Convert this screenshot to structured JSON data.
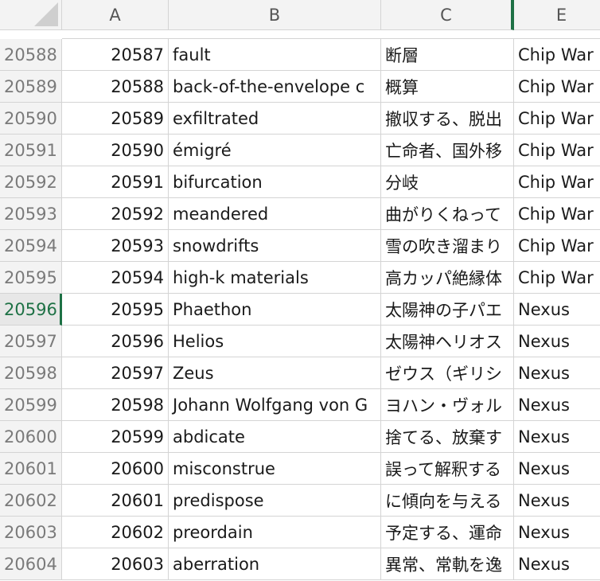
{
  "columns": [
    "A",
    "B",
    "C",
    "E"
  ],
  "active_row": "20596",
  "rows": [
    {
      "num": "20588",
      "a": "20587",
      "b": "fault",
      "c": "断層",
      "e": "Chip War"
    },
    {
      "num": "20589",
      "a": "20588",
      "b": "back-of-the-envelope c",
      "c": "概算",
      "e": "Chip War"
    },
    {
      "num": "20590",
      "a": "20589",
      "b": "exfiltrated",
      "c": "撤収する、脱出",
      "e": "Chip War"
    },
    {
      "num": "20591",
      "a": "20590",
      "b": "émigré",
      "c": "亡命者、国外移",
      "e": "Chip War"
    },
    {
      "num": "20592",
      "a": "20591",
      "b": "bifurcation",
      "c": "分岐",
      "e": "Chip War"
    },
    {
      "num": "20593",
      "a": "20592",
      "b": "meandered",
      "c": "曲がりくねって",
      "e": "Chip War"
    },
    {
      "num": "20594",
      "a": "20593",
      "b": "snowdrifts",
      "c": "雪の吹き溜まり",
      "e": "Chip War"
    },
    {
      "num": "20595",
      "a": "20594",
      "b": "high-k materials",
      "c": "高カッパ絶縁体",
      "e": "Chip War"
    },
    {
      "num": "20596",
      "a": "20595",
      "b": "Phaethon",
      "c": "太陽神の子パエ",
      "e": "Nexus"
    },
    {
      "num": "20597",
      "a": "20596",
      "b": "Helios",
      "c": "太陽神ヘリオス",
      "e": "Nexus"
    },
    {
      "num": "20598",
      "a": "20597",
      "b": "Zeus",
      "c": "ゼウス（ギリシ",
      "e": "Nexus"
    },
    {
      "num": "20599",
      "a": "20598",
      "b": "Johann Wolfgang von G",
      "c": "ヨハン・ヴォル",
      "e": "Nexus"
    },
    {
      "num": "20600",
      "a": "20599",
      "b": "abdicate",
      "c": "捨てる、放棄す",
      "e": "Nexus"
    },
    {
      "num": "20601",
      "a": "20600",
      "b": "misconstrue",
      "c": "誤って解釈する",
      "e": "Nexus"
    },
    {
      "num": "20602",
      "a": "20601",
      "b": "predispose",
      "c": "に傾向を与える",
      "e": "Nexus"
    },
    {
      "num": "20603",
      "a": "20602",
      "b": "preordain",
      "c": "予定する、運命",
      "e": "Nexus"
    },
    {
      "num": "20604",
      "a": "20603",
      "b": "aberration",
      "c": "異常、常軌を逸",
      "e": "Nexus"
    }
  ]
}
